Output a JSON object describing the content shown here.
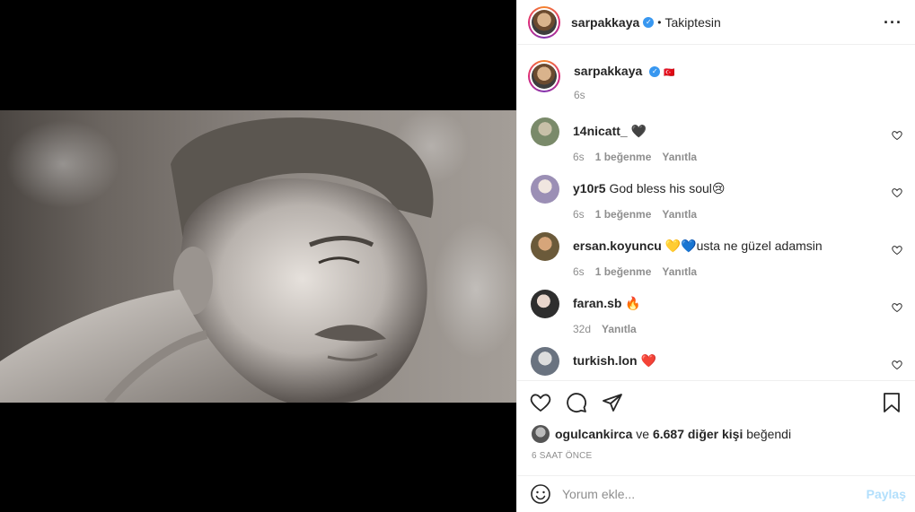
{
  "post": {
    "author": "sarpakkaya",
    "follow_status": "Takiptesin",
    "separator": "•",
    "more_label": "•••"
  },
  "caption": {
    "username": "sarpakkaya",
    "text": "🇹🇷",
    "time": "6s"
  },
  "comments": [
    {
      "username": "14nicatt_",
      "text": "🖤",
      "time": "6s",
      "likes": "1 beğenme",
      "reply": "Yanıtla",
      "avatar_color": "#7a8a6a"
    },
    {
      "username": "y10r5",
      "text": "God bless his soul😢",
      "time": "6s",
      "likes": "1 beğenme",
      "reply": "Yanıtla",
      "avatar_color": "#c9c4d6"
    },
    {
      "username": "ersan.koyuncu",
      "text": "💛💙usta ne güzel adamsin",
      "time": "6s",
      "likes": "1 beğenme",
      "reply": "Yanıtla",
      "avatar_color": "#6b5a3a"
    },
    {
      "username": "faran.sb",
      "text": "🔥",
      "time": "32d",
      "likes": "",
      "reply": "Yanıtla",
      "avatar_color": "#3a3a3a"
    },
    {
      "username": "turkish.lon",
      "text": "❤️",
      "time": "",
      "likes": "",
      "reply": "",
      "avatar_color": "#8a8f98"
    }
  ],
  "likes": {
    "user": "ogulcankirca",
    "connector": "ve",
    "count": "6.687 diğer kişi",
    "suffix": "beğendi"
  },
  "timeago": "6 SAAT ÖNCE",
  "comment_box": {
    "placeholder": "Yorum ekle...",
    "post_label": "Paylaş"
  },
  "colors": {
    "accent": "#3897f0",
    "muted": "#8e8e8e",
    "post_disabled": "#b2dffc"
  },
  "icons": [
    "heart-icon",
    "comment-icon",
    "share-icon",
    "bookmark-icon",
    "emoji-icon",
    "verified-badge-icon",
    "more-options-icon"
  ]
}
